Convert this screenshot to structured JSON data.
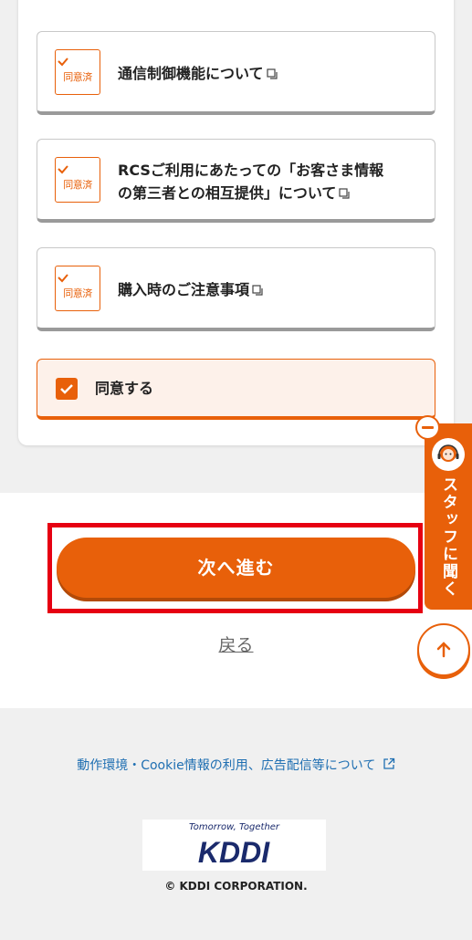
{
  "consents": [
    {
      "badge": "同意済",
      "title": "通信制御機能について"
    },
    {
      "badge": "同意済",
      "title_line1": "RCSご利用にあたっての「お客さま情報",
      "title_line2": "の第三者との相互提供」について"
    },
    {
      "badge": "同意済",
      "title": "購入時のご注意事項"
    }
  ],
  "agree": {
    "label": "同意する"
  },
  "actions": {
    "next_label": "次へ進む",
    "back_label": "戻る"
  },
  "staff": {
    "label": "スタッフに聞く"
  },
  "footer": {
    "env_link": "動作環境・Cookie情報の利用、広告配信等について",
    "logo_tagline": "Tomorrow, Together",
    "logo_text": "KDDI",
    "copyright": "© KDDI CORPORATION."
  },
  "colors": {
    "accent": "#e8600a",
    "highlight": "#e60012",
    "link": "#1f6fb2",
    "brand": "#1a2a6c"
  }
}
